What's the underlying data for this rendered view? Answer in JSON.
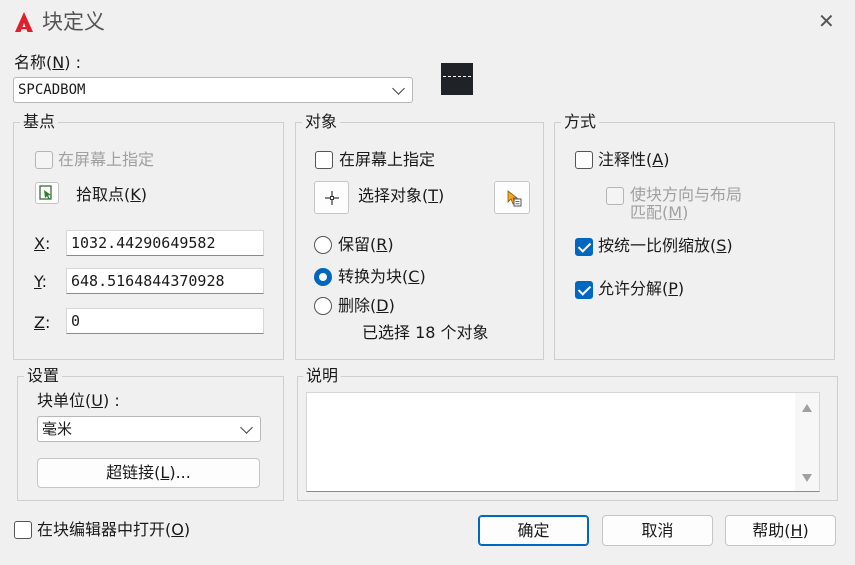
{
  "window": {
    "title": "块定义",
    "close_glyph": "✕",
    "logo_letter": "A",
    "logo_color": "#e0202a"
  },
  "name": {
    "label": "名称",
    "accel": "N",
    "value": "SPCADBOM"
  },
  "base_point": {
    "title": "基点",
    "specify_on_screen": "在屏幕上指定",
    "pick_point": "拾取点",
    "pick_point_accel": "K",
    "x_label": "X",
    "x_value": "1032.44290649582",
    "y_label": "Y",
    "y_value": "648.5164844370928",
    "z_label": "Z",
    "z_value": "0"
  },
  "objects": {
    "title": "对象",
    "specify_on_screen": "在屏幕上指定",
    "select_objects": "选择对象",
    "select_objects_accel": "T",
    "retain": "保留",
    "retain_accel": "R",
    "convert": "转换为块",
    "convert_accel": "C",
    "delete": "删除",
    "delete_accel": "D",
    "selected_count_text": "已选择 18 个对象"
  },
  "behavior": {
    "title": "方式",
    "annotative": "注释性",
    "annotative_accel": "A",
    "match_orientation_line1": "使块方向与布局",
    "match_orientation_line2": "匹配",
    "match_orientation_accel": "M",
    "scale_uniformly": "按统一比例缩放",
    "scale_uniformly_accel": "S",
    "allow_exploding": "允许分解",
    "allow_exploding_accel": "P"
  },
  "settings": {
    "title": "设置",
    "block_unit_label": "块单位",
    "block_unit_accel": "U",
    "block_unit_value": "毫米",
    "hyperlink": "超链接",
    "hyperlink_accel": "L"
  },
  "description": {
    "title": "说明",
    "value": ""
  },
  "footer": {
    "open_in_editor": "在块编辑器中打开",
    "open_in_editor_accel": "O",
    "ok": "确定",
    "cancel": "取消",
    "help": "帮助",
    "help_accel": "H"
  },
  "colors": {
    "accent": "#0067c0"
  }
}
